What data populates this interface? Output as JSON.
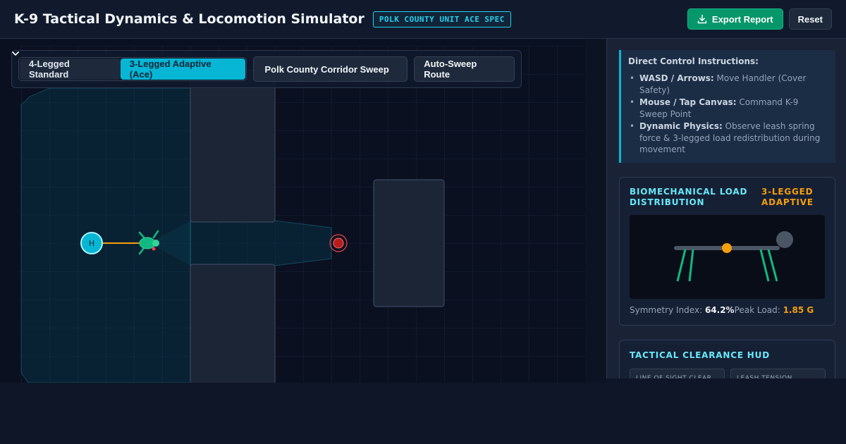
{
  "header": {
    "title": "K-9 Tactical Dynamics & Locomotion Simulator",
    "badge": "POLK COUNTY UNIT ACE SPEC",
    "export_label": "Export Report",
    "reset_label": "Reset"
  },
  "toolbar": {
    "mode_standard": "4-Legged Standard",
    "mode_adaptive": "3-Legged Adaptive (Ace)",
    "active_mode": "3-Legged Adaptive (Ace)",
    "scenario_selected": "Polk County Corridor Sweep",
    "auto_sweep_label": "Auto-Sweep Route"
  },
  "map": {
    "handler_marker": "H"
  },
  "instructions": {
    "title": "Direct Control Instructions:",
    "items": [
      {
        "key": "WASD / Arrows:",
        "text": " Move Handler (Cover Safety)"
      },
      {
        "key": "Mouse / Tap Canvas:",
        "text": " Command K-9 Sweep Point"
      },
      {
        "key": "Dynamic Physics:",
        "text": " Observe leash spring force & 3-legged load redistribution during movement"
      }
    ]
  },
  "load_card": {
    "title": "BIOMECHANICAL LOAD DISTRIBUTION",
    "mode": "3-LEGGED ADAPTIVE",
    "symmetry_label": "Symmetry Index:",
    "symmetry_value": "64.2%",
    "peak_label": "Peak Load:",
    "peak_value": "1.85 G"
  },
  "hud_card": {
    "title": "TACTICAL CLEARANCE HUD",
    "box1": "LINE OF SIGHT CLEAR",
    "box2": "LEASH TENSION"
  },
  "colors": {
    "accent": "#06b6d4",
    "export": "#059669",
    "warning": "#f59e0b",
    "target": "#ef4444"
  },
  "icons": {
    "export": "download-icon",
    "select": "chevron-down-icon",
    "handler": "handler-marker-icon",
    "dog": "k9-dog-icon",
    "target": "sweep-target-icon"
  }
}
